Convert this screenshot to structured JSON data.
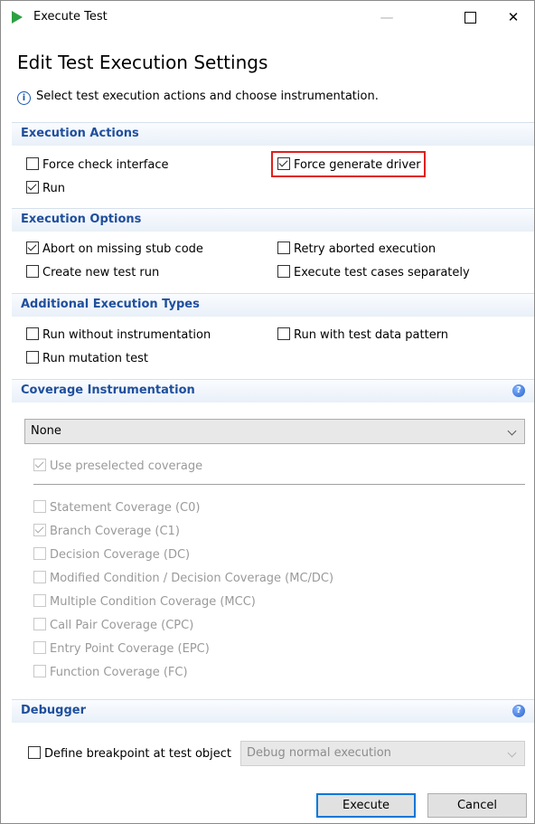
{
  "window": {
    "title": "Execute Test",
    "minimize": "—",
    "close": "✕"
  },
  "heading": "Edit Test Execution Settings",
  "info": {
    "icon": "info-icon",
    "text": "Select test execution actions and choose instrumentation."
  },
  "execution_actions": {
    "header": "Execution Actions",
    "force_check_interface": {
      "label": "Force check interface",
      "checked": false
    },
    "force_generate_driver": {
      "label": "Force generate driver",
      "checked": true
    },
    "run": {
      "label": "Run",
      "checked": true
    },
    "highlight_color": "#e0201b"
  },
  "execution_options": {
    "header": "Execution Options",
    "abort_missing_stub": {
      "label": "Abort on missing stub code",
      "checked": true
    },
    "retry_aborted": {
      "label": "Retry aborted execution",
      "checked": false
    },
    "create_new_run": {
      "label": "Create new test run",
      "checked": false
    },
    "execute_separately": {
      "label": "Execute test cases separately",
      "checked": false
    }
  },
  "additional_types": {
    "header": "Additional Execution Types",
    "without_instrumentation": {
      "label": "Run without instrumentation",
      "checked": false
    },
    "test_data_pattern": {
      "label": "Run with test data pattern",
      "checked": false
    },
    "mutation_test": {
      "label": "Run mutation test",
      "checked": false
    }
  },
  "coverage": {
    "header": "Coverage Instrumentation",
    "selected": "None",
    "use_preselected": {
      "label": "Use preselected coverage",
      "checked": true
    },
    "items": [
      {
        "label": "Statement Coverage (C0)",
        "checked": false
      },
      {
        "label": "Branch Coverage (C1)",
        "checked": true
      },
      {
        "label": "Decision Coverage (DC)",
        "checked": false
      },
      {
        "label": "Modified Condition / Decision Coverage (MC/DC)",
        "checked": false
      },
      {
        "label": "Multiple Condition Coverage (MCC)",
        "checked": false
      },
      {
        "label": "Call Pair Coverage (CPC)",
        "checked": false
      },
      {
        "label": "Entry Point Coverage (EPC)",
        "checked": false
      },
      {
        "label": "Function Coverage (FC)",
        "checked": false
      }
    ]
  },
  "debugger": {
    "header": "Debugger",
    "breakpoint": {
      "label": "Define breakpoint at test object",
      "checked": false
    },
    "mode": "Debug normal execution"
  },
  "buttons": {
    "execute": "Execute",
    "cancel": "Cancel"
  },
  "colors": {
    "section_header_text": "#1f4f9d",
    "primary_border": "#0078d7",
    "app_icon": "#2ea043"
  }
}
